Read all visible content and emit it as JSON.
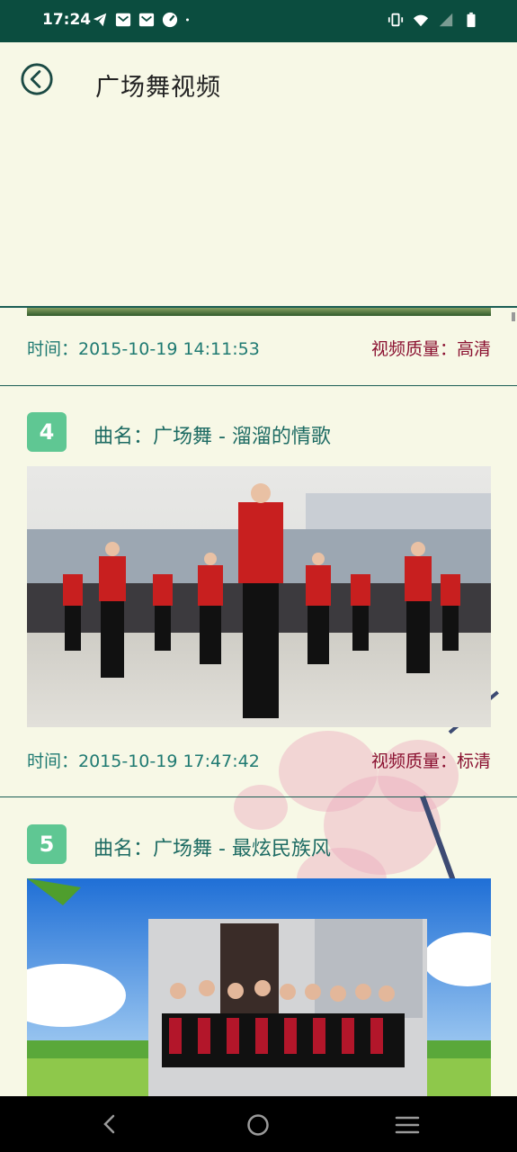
{
  "status_bar": {
    "time": "17:24",
    "left_icons": [
      "telegram-icon",
      "mail-icon",
      "mail-icon",
      "speedometer-icon",
      "dot-icon"
    ],
    "right_icons": [
      "vibrate-icon",
      "wifi-icon",
      "signal-icon",
      "battery-icon"
    ]
  },
  "header": {
    "title": "广场舞视频",
    "back_icon": "back-circle-icon"
  },
  "list": {
    "items": [
      {
        "time": "时间：2015-10-19 14:11:53",
        "quality": "视频质量：高清"
      },
      {
        "index": "4",
        "title": "曲名：广场舞 - 溜溜的情歌",
        "time": "时间：2015-10-19 17:47:42",
        "quality": "视频质量：标清"
      },
      {
        "index": "5",
        "title": "曲名：广场舞 - 最炫民族风"
      }
    ]
  },
  "colors": {
    "status_bar": "#0b4d3f",
    "badge": "#5fc793",
    "time_text": "#1f7a72",
    "quality_text": "#8a1030",
    "title_text": "#1d6b63"
  },
  "nav_bar": {
    "icons": [
      "back-triangle-icon",
      "home-circle-icon",
      "menu-lines-icon"
    ]
  }
}
